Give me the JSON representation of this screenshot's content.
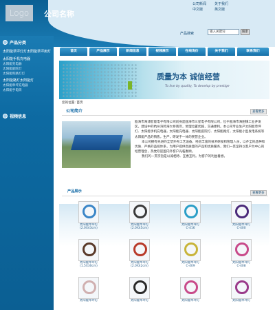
{
  "header": {
    "logo": "Logo",
    "company": "公司名称",
    "top_links": [
      "公司新闻",
      "关于我们",
      "中文版",
      "英文版"
    ],
    "search_label": "产品搜索",
    "search_placeholder": "输入关键词",
    "search_button": "搜索"
  },
  "sidebar": {
    "heading": "产品分类",
    "items": [
      "太阳能草坪灯灯太阳能草坪用灯",
      "太阳能手机充电器",
      "太阳能充电器",
      "太阳能庭院灯",
      "太阳能和路灯灯",
      "太阳能路灯太阳能灯",
      "太阳能草坪充电器",
      "太阳能手电筒"
    ],
    "heading2": "视频信息"
  },
  "nav": [
    "首页",
    "产品展示",
    "新闻信息",
    "视频展示",
    "在线询价",
    "关于我们",
    "联系我们"
  ],
  "banner": {
    "title": "质量为本  诚信经营",
    "subtitle": "To live by quality, To develop by prestige"
  },
  "breadcrumb": "您的位置: 首页",
  "about": {
    "title": "公司简介",
    "more": "查看更多",
    "text": "瓯海市海浦智能电子有限公司前身是瓯海市三星电子有限公司，位于瓯海市海田镇工业开发区，建设中的杭州湾跨海大桥南岸，地理位置优越，交通便利。本公司专业生产太阳能草坪灯、太阳能手机充电器，太阳能充电器、太阳能庭院灯、太阳能路灯，太阳能小型发电系统等太阳能产品的销售，生产，研发于一体的民营企业。",
    "text2": "本公司拥有先进的全塑外壳工艺设备，经验丰富的技术研发和管理人员，以齐全的品种和优质、严格的品控体系，为用户提供高质量的产品和优质服务，我们一贯坚持以客户为中心的经营理念，热忱欢迎国内外客户光临惠顾。",
    "text3": "我们的一贯宗旨是以诚相待、互惠互利。为客户的利益着想。"
  },
  "products": {
    "title": "产品展示",
    "more": "查看更多",
    "items": [
      {
        "name": "太阳能草坪灯",
        "code": "(2.0X43cm)",
        "color": "#3b86c7"
      },
      {
        "name": "太阳能草坪灯",
        "code": "(2.0X45cm)",
        "color": "#3a3a3a"
      },
      {
        "name": "太阳能草坪灯",
        "code": "C-416",
        "color": "#2a9ec7"
      },
      {
        "name": "太阳能草坪灯",
        "code": "C-400",
        "color": "#4b2a7a"
      },
      {
        "name": "太阳能草坪灯",
        "code": "(1.5X30cm)",
        "color": "#5a3a2a"
      },
      {
        "name": "太阳能草坪灯",
        "code": "(2.0X42cm)",
        "color": "#b83a2a"
      },
      {
        "name": "太阳能草坪灯",
        "code": "C-409",
        "color": "#c8b43a"
      },
      {
        "name": "太阳能草坪灯",
        "code": "C-408",
        "color": "#c84a8a"
      },
      {
        "name": "太阳能草坪灯",
        "code": "",
        "color": "#d0b0b0"
      },
      {
        "name": "太阳能草坪灯",
        "code": "",
        "color": "#2a2a2a"
      },
      {
        "name": "太阳能草坪灯",
        "code": "",
        "color": "#c84a8a"
      },
      {
        "name": "太阳能草坪灯",
        "code": "",
        "color": "#9a3a8a"
      }
    ]
  }
}
